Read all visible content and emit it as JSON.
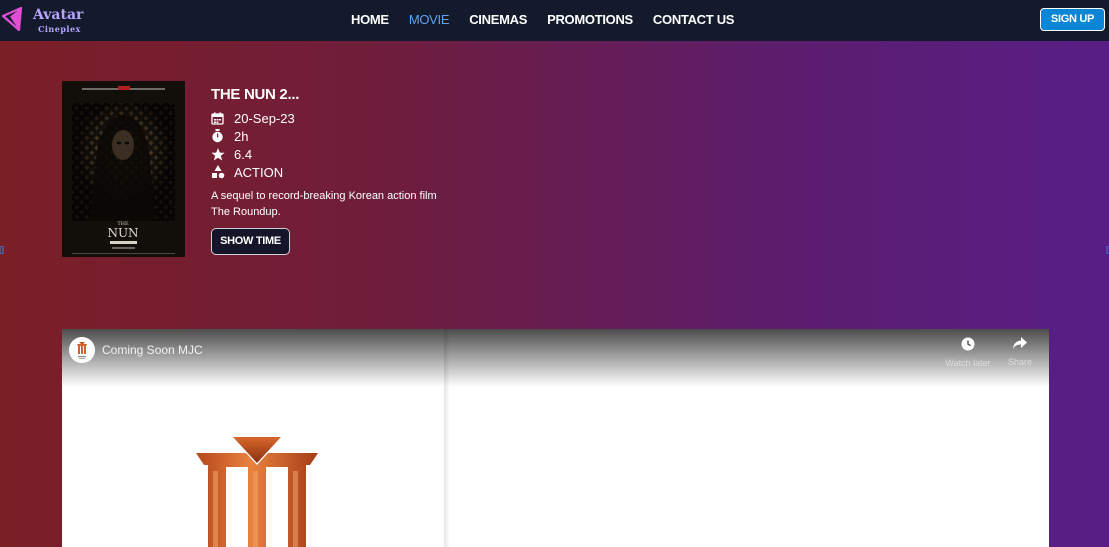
{
  "brand": {
    "name": "Avatar",
    "tagline": "Cineplex",
    "accent": "#b9a4ff",
    "logo_icon_color": "#e04fd6"
  },
  "nav": {
    "items": [
      {
        "label": "HOME",
        "active": false
      },
      {
        "label": "MOVIE",
        "active": true
      },
      {
        "label": "CINEMAS",
        "active": false
      },
      {
        "label": "PROMOTIONS",
        "active": false
      },
      {
        "label": "CONTACT US",
        "active": false
      }
    ],
    "active_color": "#5ea3f5",
    "signup_label": "SIGN UP",
    "signup_color": "#0b86d6"
  },
  "movie": {
    "title": "THE NUN 2...",
    "release_date": "20-Sep-23",
    "duration": "2h",
    "rating": "6.4",
    "genre": "ACTION",
    "description": "A sequel to record-breaking Korean action film The Roundup.",
    "showtime_label": "SHOW TIME",
    "icons": {
      "date": "calendar-icon",
      "duration": "stopwatch-icon",
      "rating": "star-icon",
      "genre": "shapes-icon"
    }
  },
  "video": {
    "title": "Coming Soon MJC",
    "watch_later_label": "Watch later",
    "share_label": "Share"
  }
}
